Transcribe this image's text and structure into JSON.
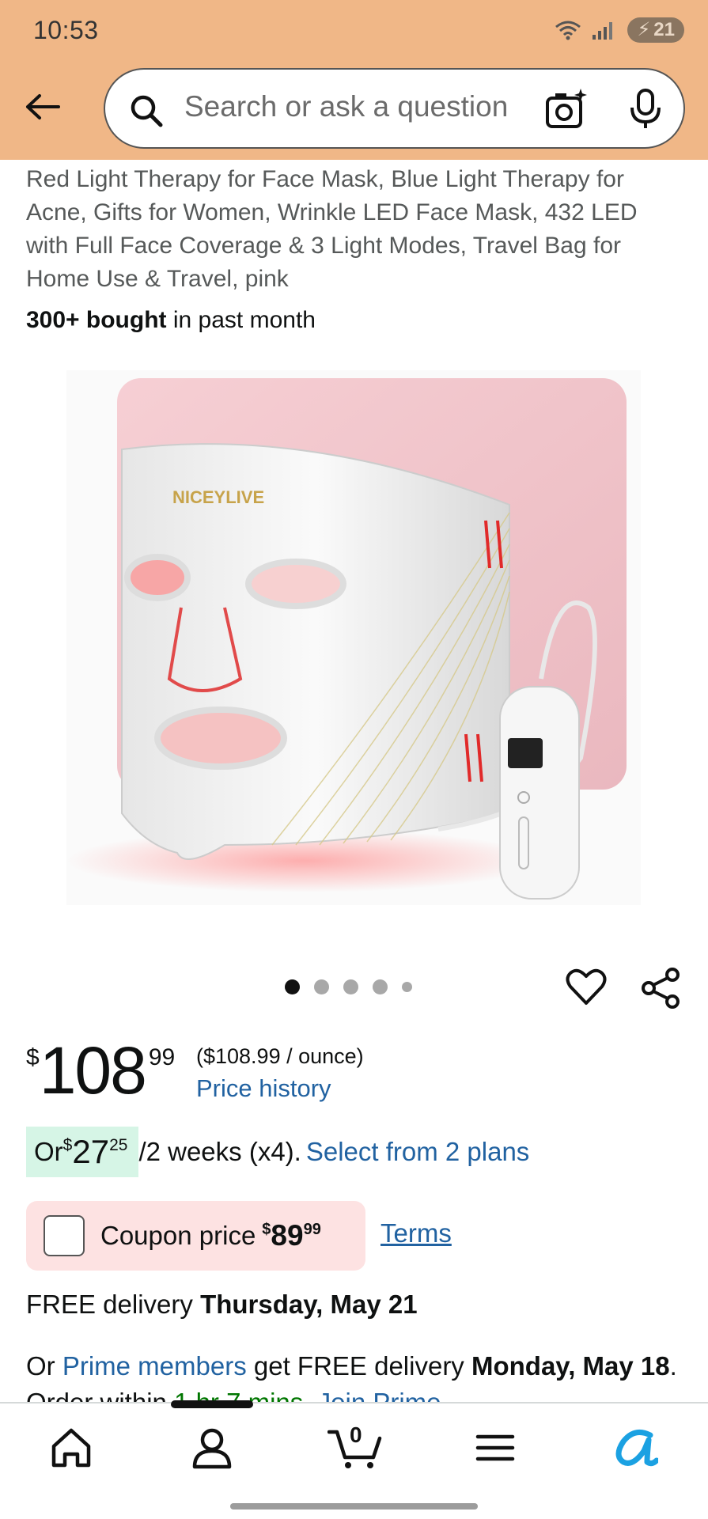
{
  "status_bar": {
    "time": "10:53",
    "battery": "21",
    "wifi_label": "5"
  },
  "search": {
    "placeholder": "Search or ask a question"
  },
  "product": {
    "title": "Red Light Therapy for Face Mask, Blue Light Therapy for Acne, Gifts for Women, Wrinkle LED Face Mask, 432 LED with Full Face Coverage & 3 Light Modes, Travel Bag for Home Use & Travel, pink",
    "bought_bold": "300+ bought",
    "bought_rest": " in past month",
    "brand_on_image": "NICEYLIVE"
  },
  "gallery": {
    "image_count": 5,
    "active_index": 0
  },
  "price": {
    "symbol": "$",
    "whole": "108",
    "fraction": "99",
    "per_unit": "($108.99 / ounce)",
    "history_link": "Price history"
  },
  "installment": {
    "prefix": "Or ",
    "symbol": "$",
    "whole": "27",
    "fraction": "25",
    "schedule": "/2 weeks (x4).",
    "link": "Select from 2 plans"
  },
  "coupon": {
    "label": "Coupon price",
    "symbol": "$",
    "whole": "89",
    "fraction": "99",
    "terms": "Terms"
  },
  "delivery": {
    "prefix": "FREE delivery ",
    "date": "Thursday, May 21"
  },
  "prime": {
    "prefix": "Or ",
    "link": "Prime members",
    "middle": " get FREE delivery ",
    "date": "Monday, May 18",
    "order_within": ". Order within ",
    "countdown": "1 hr 7 mins",
    "join": ". Join Prime"
  },
  "bottom_nav": {
    "items": [
      "home-icon",
      "account-icon",
      "cart-icon",
      "menu-icon",
      "rufus-icon"
    ],
    "cart_count": "0"
  },
  "colors": {
    "header": "#f0b787",
    "link": "#2162a1",
    "coupon_bg": "#fde2e2",
    "installment_bg": "#d6f5e6"
  }
}
